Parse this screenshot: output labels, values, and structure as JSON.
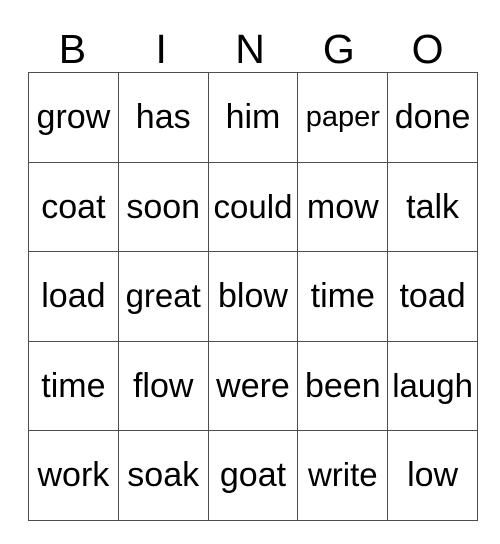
{
  "card": {
    "title": "BINGO",
    "header_letters": [
      "B",
      "I",
      "N",
      "G",
      "O"
    ],
    "columns": 5,
    "rows": 5,
    "colors": {
      "background": "#ffffff",
      "grid_line": "#4d4d4d",
      "text": "#000000"
    },
    "grid": [
      [
        {
          "word": "grow",
          "fit": "normal"
        },
        {
          "word": "has",
          "fit": "normal"
        },
        {
          "word": "him",
          "fit": "normal"
        },
        {
          "word": "paper",
          "fit": "tight"
        },
        {
          "word": "done",
          "fit": "normal"
        }
      ],
      [
        {
          "word": "coat",
          "fit": "normal"
        },
        {
          "word": "soon",
          "fit": "normal"
        },
        {
          "word": "could",
          "fit": "snug"
        },
        {
          "word": "mow",
          "fit": "normal"
        },
        {
          "word": "talk",
          "fit": "normal"
        }
      ],
      [
        {
          "word": "load",
          "fit": "normal"
        },
        {
          "word": "great",
          "fit": "snug"
        },
        {
          "word": "blow",
          "fit": "normal"
        },
        {
          "word": "time",
          "fit": "normal"
        },
        {
          "word": "toad",
          "fit": "normal"
        }
      ],
      [
        {
          "word": "time",
          "fit": "normal"
        },
        {
          "word": "flow",
          "fit": "normal"
        },
        {
          "word": "were",
          "fit": "normal"
        },
        {
          "word": "been",
          "fit": "normal"
        },
        {
          "word": "laugh",
          "fit": "snug"
        }
      ],
      [
        {
          "word": "work",
          "fit": "normal"
        },
        {
          "word": "soak",
          "fit": "normal"
        },
        {
          "word": "goat",
          "fit": "normal"
        },
        {
          "word": "write",
          "fit": "snug"
        },
        {
          "word": "low",
          "fit": "normal"
        }
      ]
    ]
  }
}
